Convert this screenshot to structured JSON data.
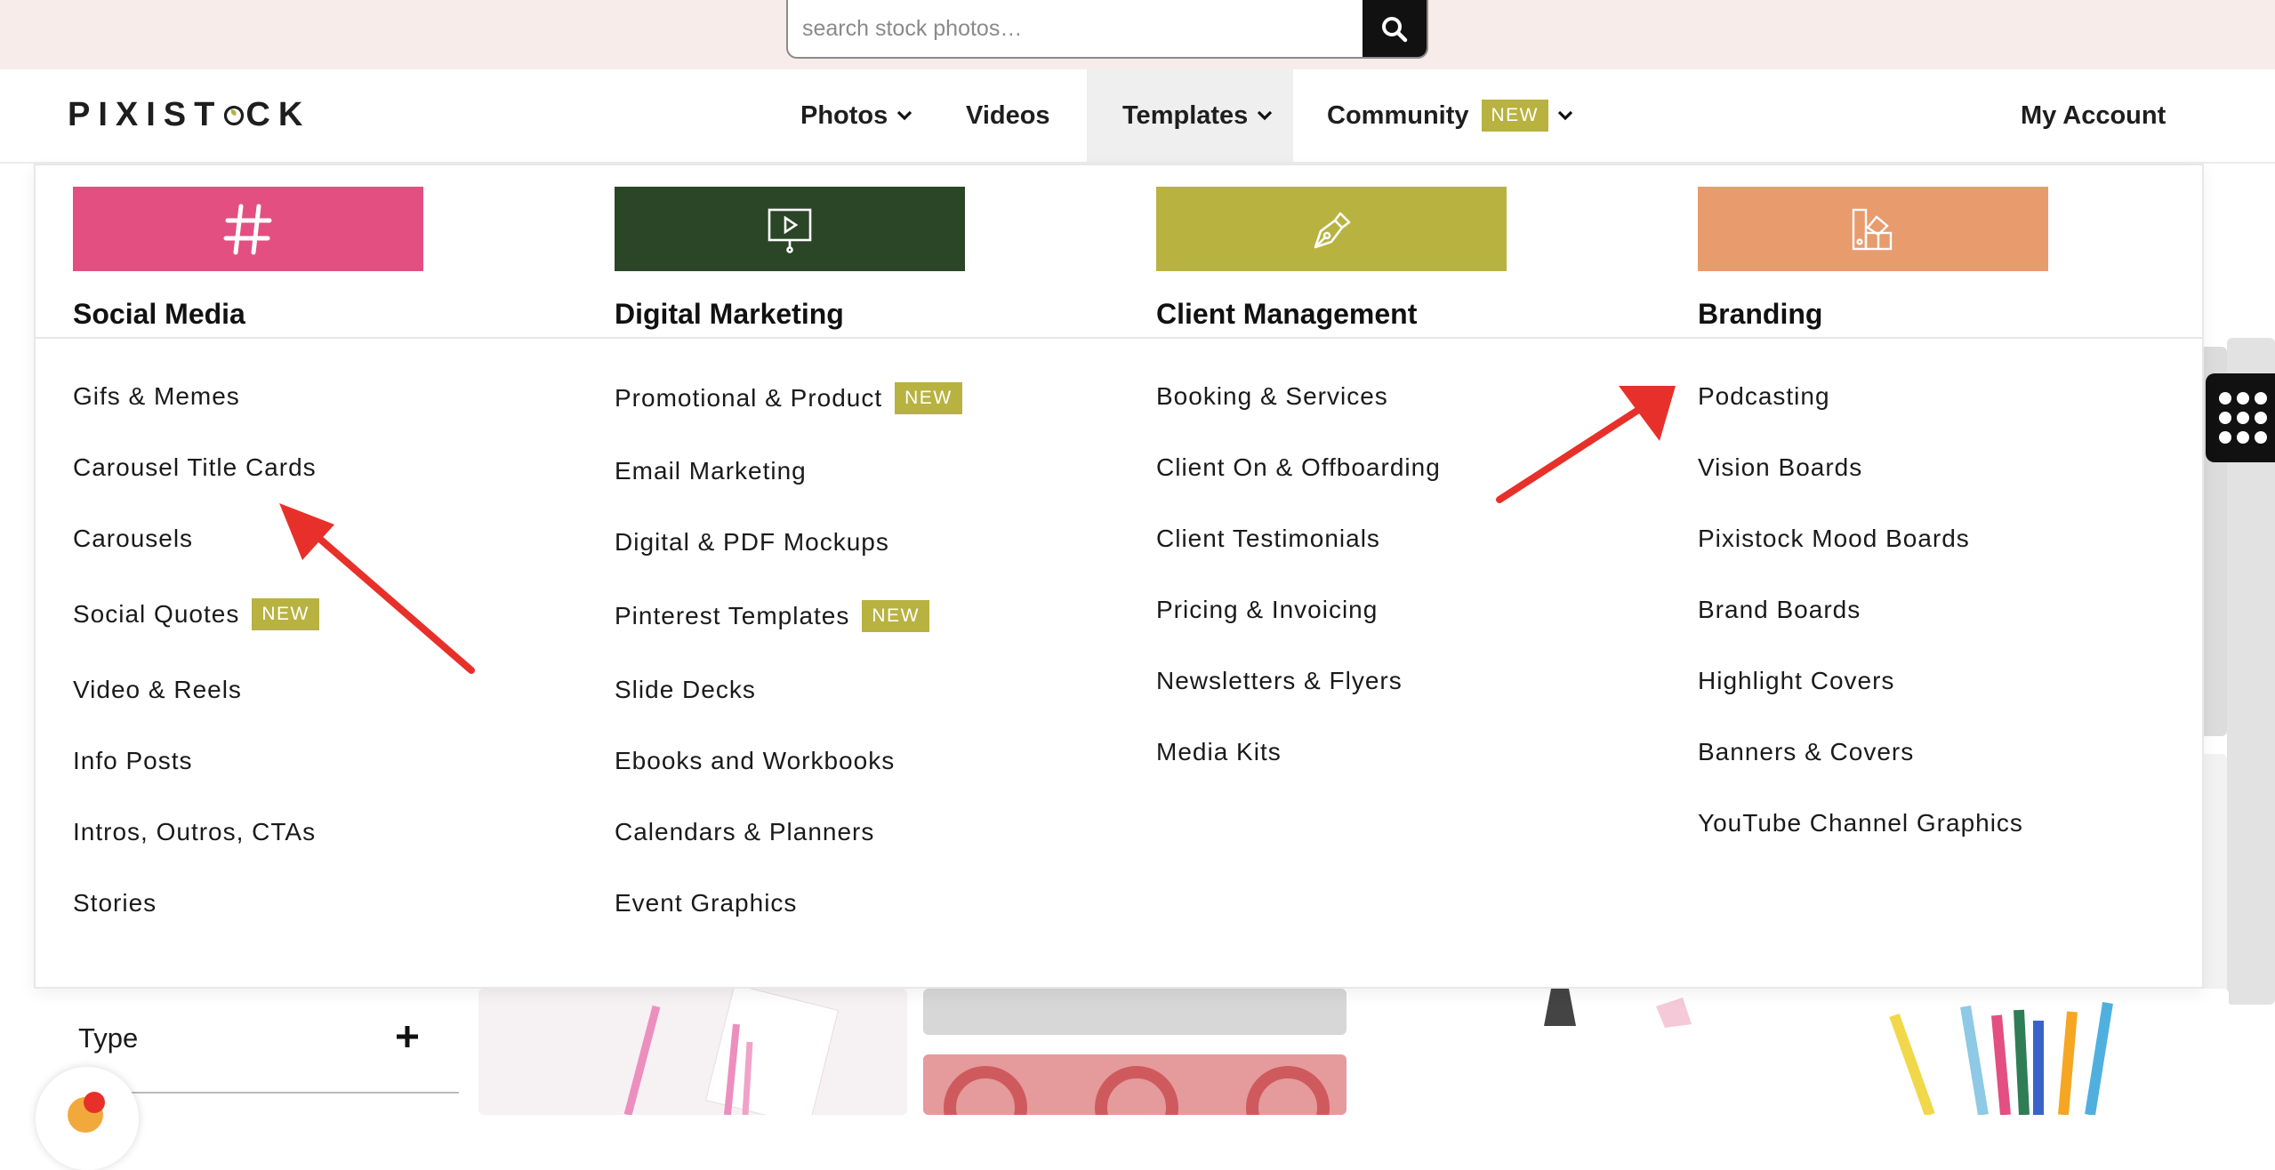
{
  "search": {
    "placeholder": "search stock photos…"
  },
  "header": {
    "logo": {
      "before": "PIXIST",
      "after": "CK"
    },
    "nav": {
      "photos": "Photos",
      "videos": "Videos",
      "templates": "Templates",
      "community": "Community",
      "community_badge": "NEW",
      "account": "My Account"
    }
  },
  "menu": {
    "columns": [
      {
        "title": "Social Media",
        "color": "#e24f80",
        "icon": "hashtag-icon",
        "items": [
          {
            "label": "Gifs & Memes"
          },
          {
            "label": "Carousel Title Cards"
          },
          {
            "label": "Carousels"
          },
          {
            "label": "Social Quotes",
            "badge": "NEW"
          },
          {
            "label": "Video & Reels"
          },
          {
            "label": "Info Posts"
          },
          {
            "label": "Intros, Outros, CTAs"
          },
          {
            "label": "Stories"
          }
        ]
      },
      {
        "title": "Digital Marketing",
        "color": "#2b4527",
        "icon": "presentation-icon",
        "items": [
          {
            "label": "Promotional & Product",
            "badge": "NEW"
          },
          {
            "label": "Email Marketing"
          },
          {
            "label": "Digital & PDF Mockups"
          },
          {
            "label": "Pinterest Templates",
            "badge": "NEW"
          },
          {
            "label": "Slide Decks"
          },
          {
            "label": "Ebooks and Workbooks"
          },
          {
            "label": "Calendars & Planners"
          },
          {
            "label": "Event Graphics"
          }
        ]
      },
      {
        "title": "Client Management",
        "color": "#b8b241",
        "icon": "pen-nib-icon",
        "items": [
          {
            "label": "Booking & Services"
          },
          {
            "label": "Client On & Offboarding"
          },
          {
            "label": "Client Testimonials"
          },
          {
            "label": "Pricing & Invoicing"
          },
          {
            "label": "Newsletters & Flyers"
          },
          {
            "label": "Media Kits"
          }
        ]
      },
      {
        "title": "Branding",
        "color": "#e89b6d",
        "icon": "swatches-icon",
        "items": [
          {
            "label": "Podcasting"
          },
          {
            "label": "Vision Boards"
          },
          {
            "label": "Pixistock Mood Boards"
          },
          {
            "label": "Brand Boards"
          },
          {
            "label": "Highlight Covers"
          },
          {
            "label": "Banners & Covers"
          },
          {
            "label": "YouTube Channel Graphics"
          }
        ]
      }
    ]
  },
  "filter": {
    "label": "Type"
  },
  "colors": {
    "accent": "#b8b241",
    "arrow": "#e8302a",
    "topband": "#f7ecea"
  }
}
